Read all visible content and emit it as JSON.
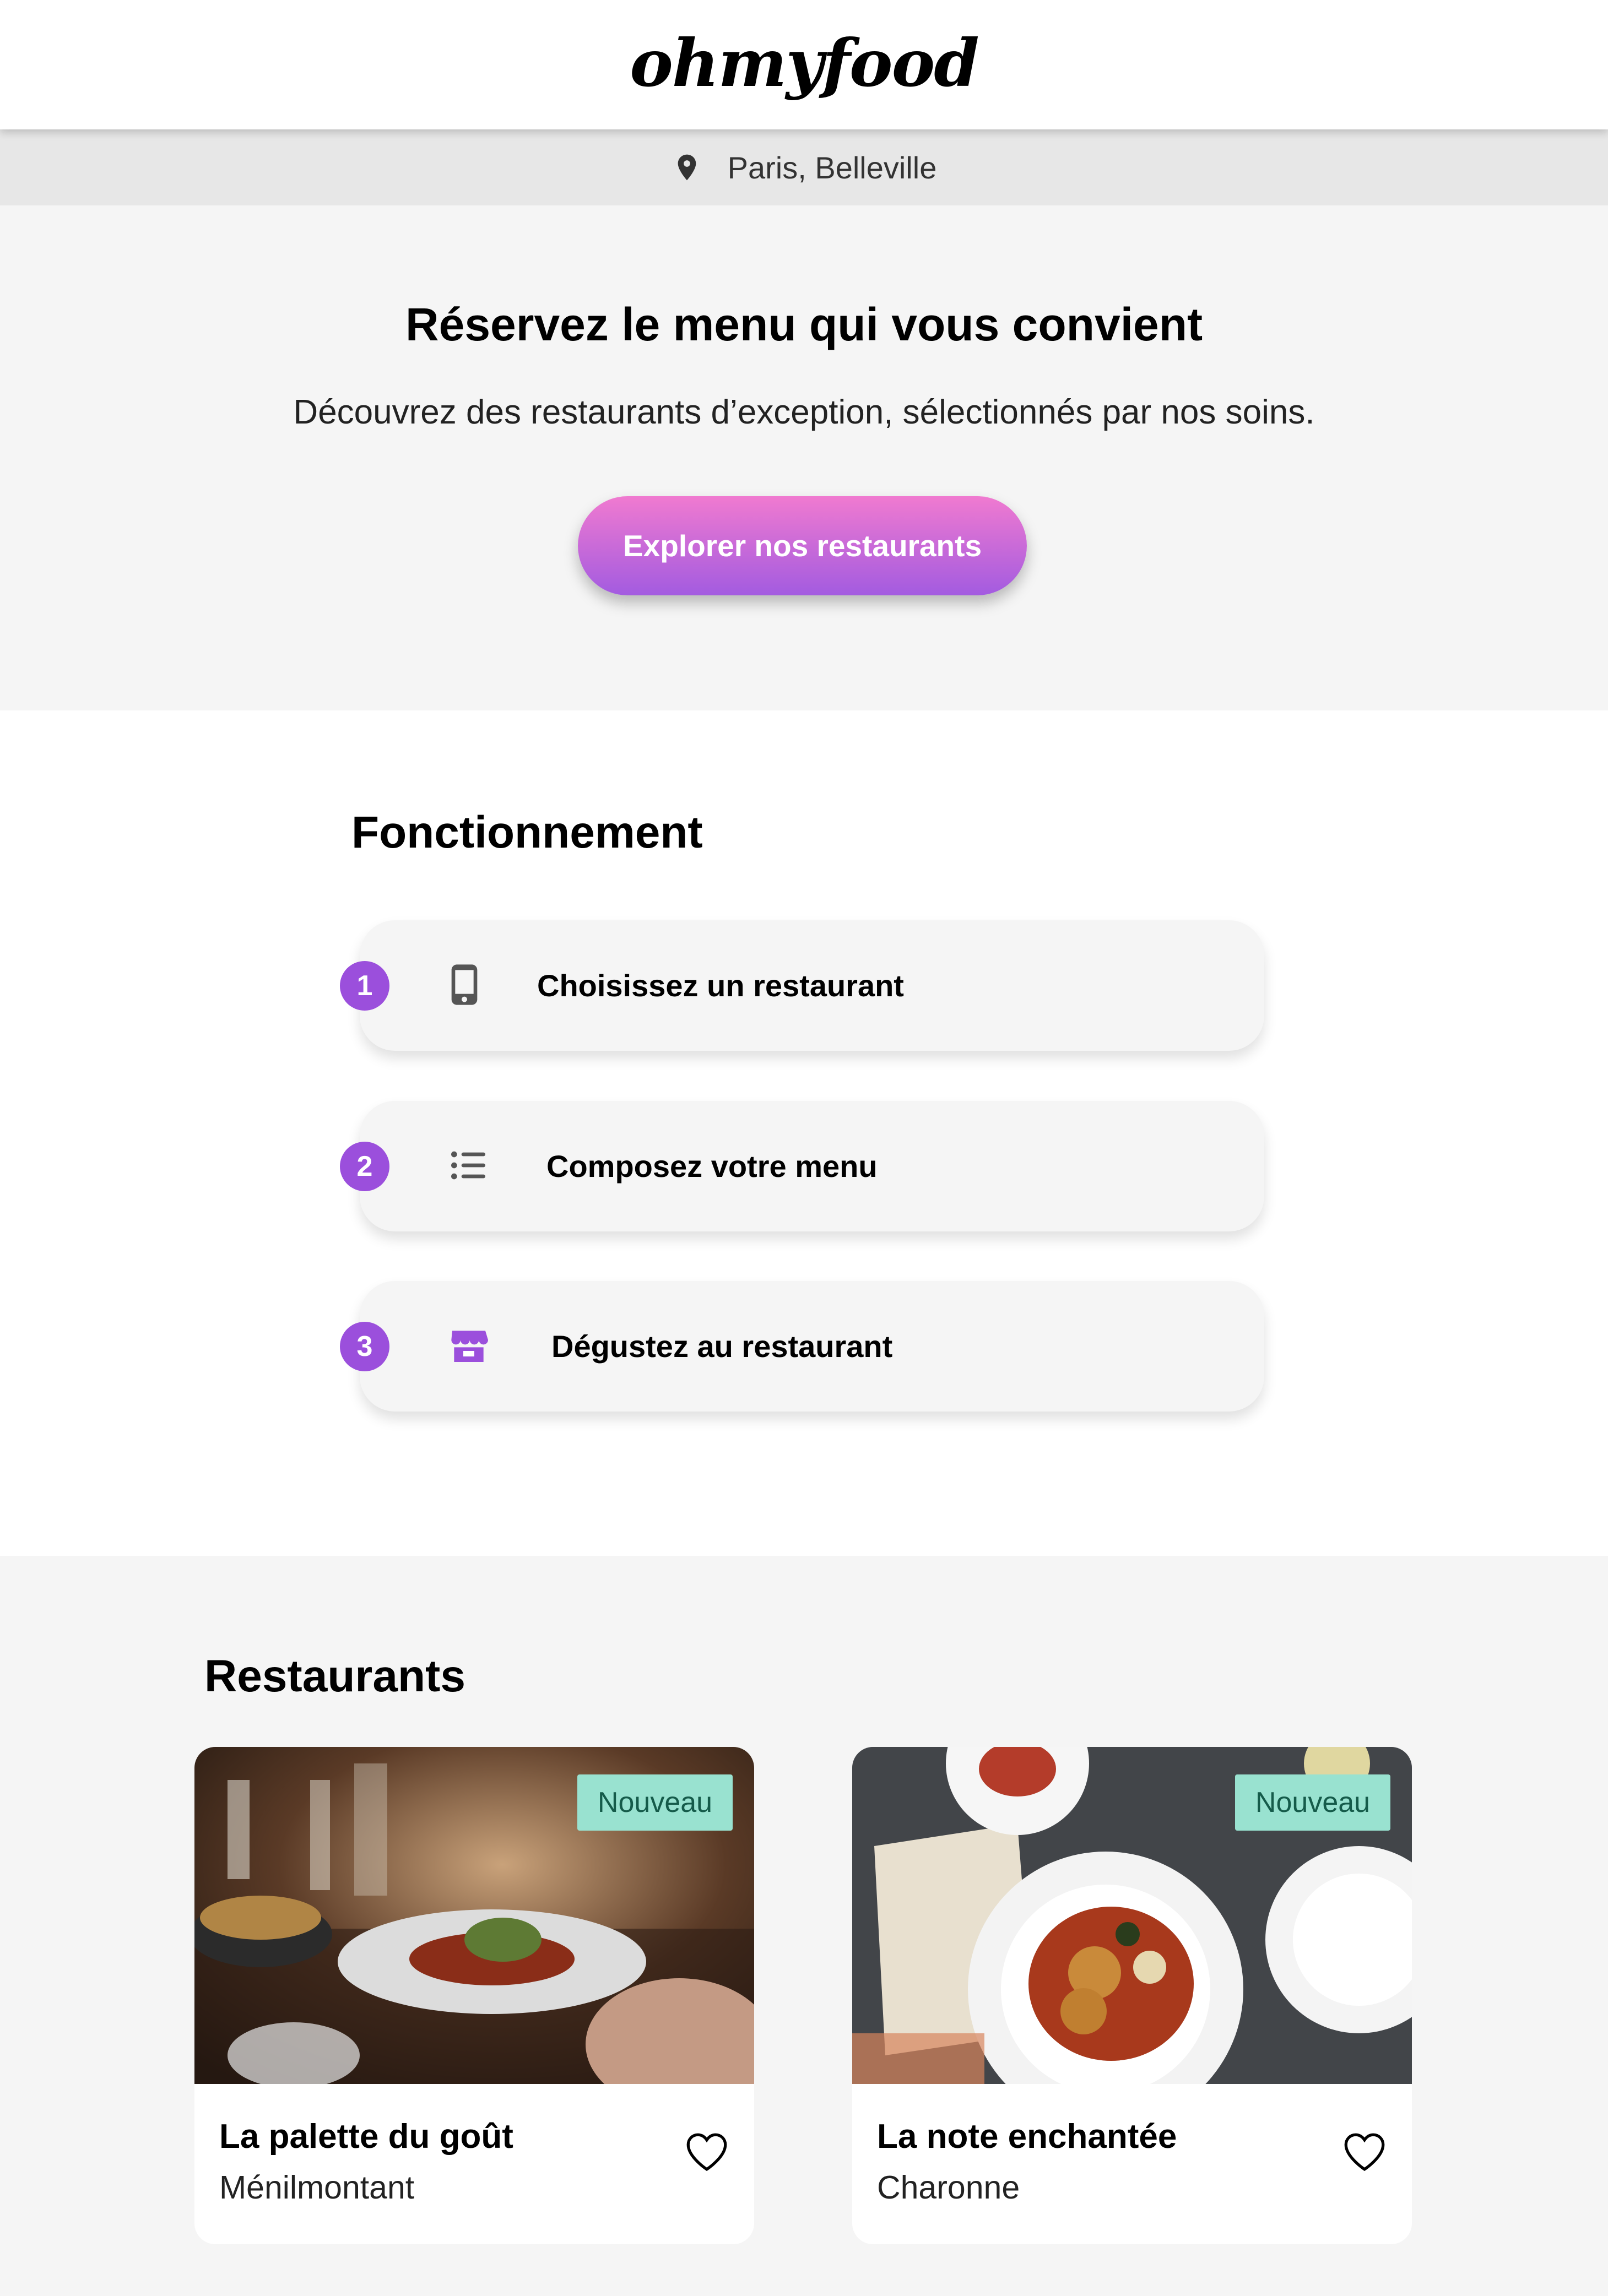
{
  "header": {
    "logo": "ohmyfood"
  },
  "location": {
    "label": "Paris, Belleville",
    "icon": "location-pin-icon"
  },
  "hero": {
    "title": "Réservez le menu qui vous convient",
    "subtitle": "Découvrez des restaurants d’exception, sélectionnés par nos soins.",
    "cta_label": "Explorer nos restaurants"
  },
  "how": {
    "title": "Fonctionnement",
    "steps": [
      {
        "number": "1",
        "icon": "mobile-phone-icon",
        "label": "Choisissez un restaurant"
      },
      {
        "number": "2",
        "icon": "list-icon",
        "label": "Composez votre menu"
      },
      {
        "number": "3",
        "icon": "store-icon",
        "label": "Dégustez au restaurant"
      }
    ]
  },
  "restaurants": {
    "title": "Restaurants",
    "items": [
      {
        "name": "La palette du goût",
        "location": "Ménilmontant",
        "badge": "Nouveau",
        "favorite_icon": "heart-outline-icon"
      },
      {
        "name": "La note enchantée",
        "location": "Charonne",
        "badge": "Nouveau",
        "favorite_icon": "heart-outline-icon"
      }
    ]
  },
  "colors": {
    "accent": "#9b4fdc",
    "cta_gradient_top": "#f07ad0",
    "cta_gradient_bottom": "#a35be0",
    "badge_bg": "#99e2d0",
    "badge_text": "#155b4a"
  }
}
